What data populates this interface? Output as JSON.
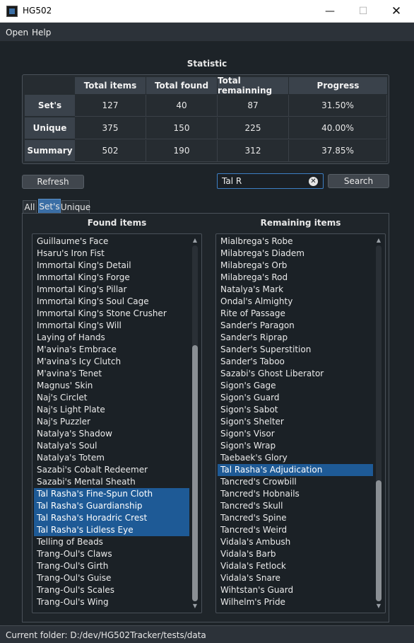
{
  "window": {
    "title": "HG502",
    "minimize_glyph": "—",
    "maximize_glyph": "☐",
    "close_glyph": "✕"
  },
  "menu": {
    "open": "Open",
    "help": "Help"
  },
  "statistic": {
    "title": "Statistic",
    "columns": [
      "Total items",
      "Total found",
      "Total remainning",
      "Progress"
    ],
    "rows": [
      {
        "label": "Set's",
        "values": [
          "127",
          "40",
          "87",
          "31.50%"
        ]
      },
      {
        "label": "Unique",
        "values": [
          "375",
          "150",
          "225",
          "40.00%"
        ]
      },
      {
        "label": "Summary",
        "values": [
          "502",
          "190",
          "312",
          "37.85%"
        ]
      }
    ]
  },
  "controls": {
    "refresh_label": "Refresh",
    "search_value": "Tal R",
    "search_label": "Search",
    "clear_glyph": "✕"
  },
  "tabs": {
    "all": "All",
    "sets": "Set's",
    "unique": "Unique",
    "active": "Set's"
  },
  "found": {
    "title": "Found items",
    "items": [
      "Guillaume's Face",
      "Hsaru's Iron Fist",
      "Immortal King's Detail",
      "Immortal King's Forge",
      "Immortal King's Pillar",
      "Immortal King's Soul Cage",
      "Immortal King's Stone Crusher",
      "Immortal King's Will",
      "Laying of Hands",
      "M'avina's Embrace",
      "M'avina's Icy Clutch",
      "M'avina's Tenet",
      "Magnus' Skin",
      "Naj's Circlet",
      "Naj's Light Plate",
      "Naj's Puzzler",
      "Natalya's Shadow",
      "Natalya's Soul",
      "Natalya's Totem",
      "Sazabi's Cobalt Redeemer",
      "Sazabi's Mental Sheath",
      "Tal Rasha's Fine-Spun Cloth",
      "Tal Rasha's Guardianship",
      "Tal Rasha's Horadric Crest",
      "Tal Rasha's Lidless Eye",
      "Telling of Beads",
      "Trang-Oul's Claws",
      "Trang-Oul's Girth",
      "Trang-Oul's Guise",
      "Trang-Oul's Scales",
      "Trang-Oul's Wing"
    ],
    "selected": [
      21,
      22,
      23,
      24
    ],
    "scroll_fraction_start": 0.28,
    "scroll_fraction_size": 0.72
  },
  "remaining": {
    "title": "Remaining items",
    "items": [
      "Mialbrega's Robe",
      "Milabrega's Diadem",
      "Milabrega's Orb",
      "Milabrega's Rod",
      "Natalya's Mark",
      "Ondal's Almighty",
      "Rite of Passage",
      "Sander's Paragon",
      "Sander's Riprap",
      "Sander's Superstition",
      "Sander's Taboo",
      "Sazabi's Ghost Liberator",
      "Sigon's Gage",
      "Sigon's Guard",
      "Sigon's Sabot",
      "Sigon's Shelter",
      "Sigon's Visor",
      "Sigon's Wrap",
      "Taebaek's Glory",
      "Tal Rasha's Adjudication",
      "Tancred's Crowbill",
      "Tancred's Hobnails",
      "Tancred's Skull",
      "Tancred's Spine",
      "Tancred's Weird",
      "Vidala's Ambush",
      "Vidala's Barb",
      "Vidala's Fetlock",
      "Vidala's Snare",
      "Wihtstan's Guard",
      "Wilhelm's Pride"
    ],
    "selected": [
      19
    ],
    "scroll_fraction_start": 0.66,
    "scroll_fraction_size": 0.34
  },
  "status": {
    "text": "Current folder: D:/dev/HG502Tracker/tests/data"
  }
}
